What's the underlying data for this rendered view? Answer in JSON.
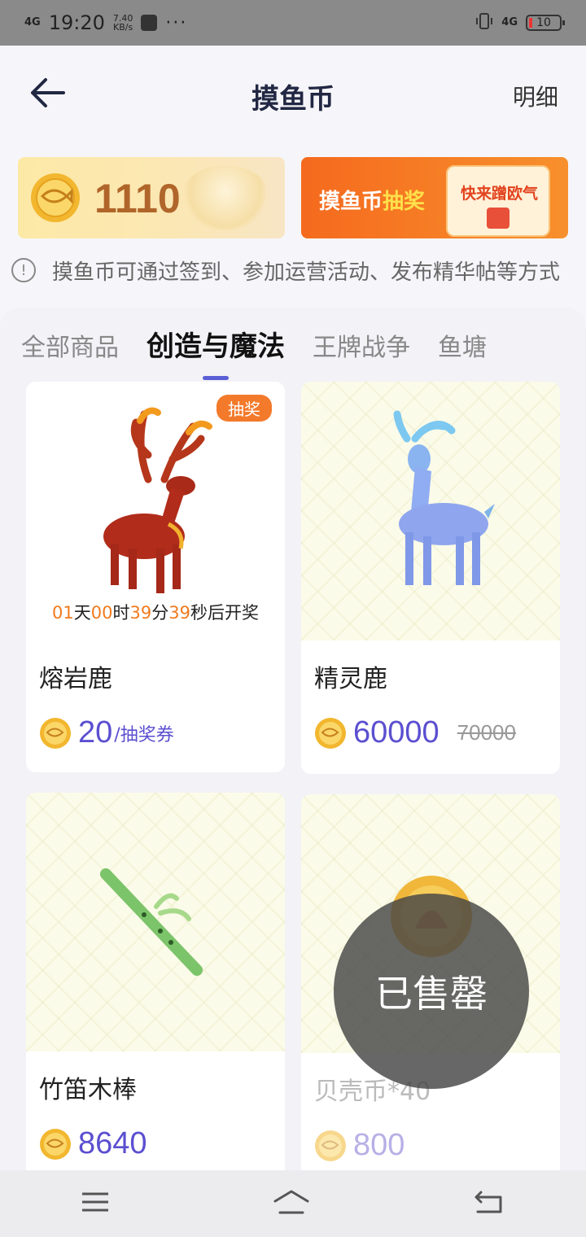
{
  "status_bar": {
    "network": "4G",
    "time": "19:20",
    "speed_value": "7.40",
    "speed_unit": "KB/s",
    "more": "···",
    "network_right": "4G",
    "battery": "10"
  },
  "header": {
    "title": "摸鱼币",
    "detail_link": "明细"
  },
  "balance": {
    "amount": "1110"
  },
  "lottery_banner": {
    "title_prefix": "摸鱼币",
    "title_highlight": "抽奖",
    "slogan": "快来蹭欧气"
  },
  "notice": {
    "text": "摸鱼币可通过签到、参加运营活动、发布精华帖等方式"
  },
  "tabs": [
    {
      "label": "全部商品",
      "active": false
    },
    {
      "label": "创造与魔法",
      "active": true
    },
    {
      "label": "王牌战争",
      "active": false
    },
    {
      "label": "鱼塘",
      "active": false
    }
  ],
  "products": [
    {
      "name": "熔岩鹿",
      "badge": "抽奖",
      "countdown": {
        "days": "01",
        "d_unit": "天",
        "hours": "00",
        "h_unit": "时",
        "minutes": "39",
        "m_unit": "分",
        "seconds": "39",
        "s_unit": "秒后开奖"
      },
      "price": "20",
      "price_unit": "/抽奖券"
    },
    {
      "name": "精灵鹿",
      "price": "60000",
      "old_price": "70000"
    },
    {
      "name": "竹笛木棒",
      "price": "8640"
    },
    {
      "name": "贝壳币*40",
      "price": "800",
      "status": "已售罄"
    }
  ],
  "colors": {
    "accent": "#5b5fd6",
    "price": "#5b4fd0",
    "orange": "#f07b1e",
    "balance": "#b0652a"
  }
}
